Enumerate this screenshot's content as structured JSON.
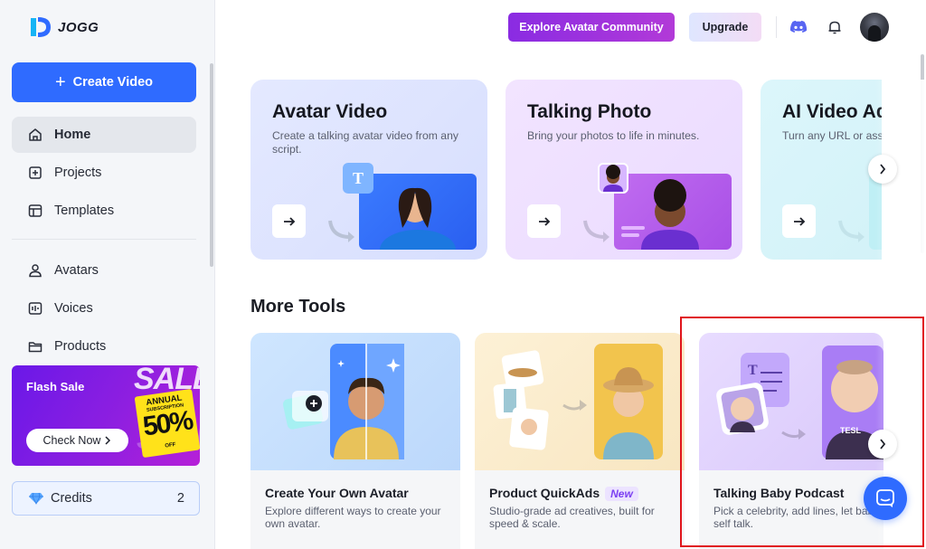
{
  "app": {
    "name": "JOGG"
  },
  "sidebar": {
    "create_label": "Create Video",
    "nav": [
      {
        "label": "Home",
        "icon": "home-icon"
      },
      {
        "label": "Projects",
        "icon": "projects-icon"
      },
      {
        "label": "Templates",
        "icon": "templates-icon"
      },
      {
        "label": "Avatars",
        "icon": "avatar-icon"
      },
      {
        "label": "Voices",
        "icon": "voice-icon"
      },
      {
        "label": "Products",
        "icon": "products-icon"
      }
    ],
    "promo": {
      "title": "Flash Sale",
      "button": "Check Now",
      "sale_word": "SALE",
      "badge_line1": "ANNUAL",
      "badge_line2": "SUBSCRIPTION",
      "badge_pct": "50%",
      "badge_off": "OFF"
    },
    "credits": {
      "label": "Credits",
      "count": "2"
    }
  },
  "header": {
    "explore_label": "Explore Avatar Community",
    "upgrade_label": "Upgrade"
  },
  "features": [
    {
      "title": "Avatar Video",
      "desc": "Create a talking avatar video from any script."
    },
    {
      "title": "Talking Photo",
      "desc": "Bring your photos to life in minutes."
    },
    {
      "title": "AI Video Ads",
      "desc": "Turn any URL or asset into video ads."
    }
  ],
  "more_tools": {
    "title": "More Tools",
    "items": [
      {
        "title": "Create Your Own Avatar",
        "desc": "Explore different ways to create your own avatar.",
        "tag": ""
      },
      {
        "title": "Product QuickAds",
        "desc": "Studio-grade ad creatives, built for speed & scale.",
        "tag": "New"
      },
      {
        "title": "Talking Baby Podcast",
        "desc": "Pick a celebrity, add lines, let baby self talk.",
        "tag": ""
      }
    ]
  },
  "colors": {
    "primary": "#2f6bff",
    "accent_purple": "#8a2be2",
    "highlight": "#e0151c"
  }
}
